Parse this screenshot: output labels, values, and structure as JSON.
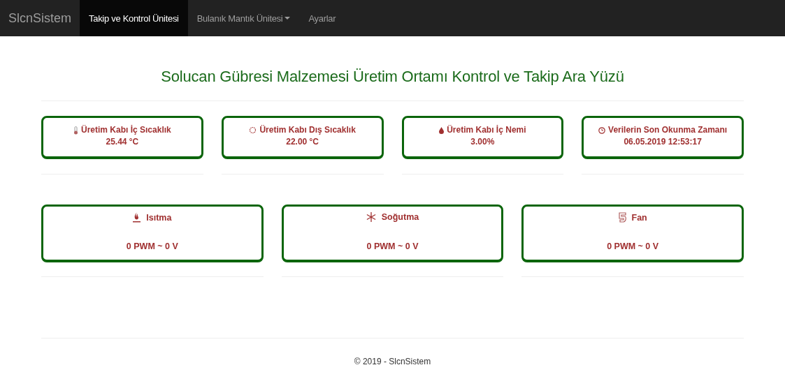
{
  "navbar": {
    "brand": "SlcnSistem",
    "items": [
      {
        "label": "Takip ve Kontrol Ünitesi",
        "selected": true,
        "dropdown": false
      },
      {
        "label": "Bulanık Mantık Ünitesi",
        "selected": false,
        "dropdown": true
      },
      {
        "label": "Ayarlar",
        "selected": false,
        "dropdown": false
      }
    ]
  },
  "title": "Solucan Gübresi Malzemesi Üretim Ortamı Kontrol ve Takip Ara Yüzü",
  "sensors": [
    {
      "label": "Üretim Kabı İç Sıcaklık",
      "value": "25.44 °C"
    },
    {
      "label": "Üretim Kabı Dış Sıcaklık",
      "value": "22.00 °C"
    },
    {
      "label": "Üretim Kabı İç Nemi",
      "value": "3.00%"
    },
    {
      "label": "Verilerin Son Okunma Zamanı",
      "value": "06.05.2019 12:53:17"
    }
  ],
  "actuators": [
    {
      "label": "Isıtma",
      "value": "0 PWM ~ 0 V"
    },
    {
      "label": "Soğutma",
      "value": "0 PWM ~ 0 V"
    },
    {
      "label": "Fan",
      "value": "0 PWM ~ 0 V"
    }
  ],
  "footer": "© 2019 - SlcnSistem"
}
